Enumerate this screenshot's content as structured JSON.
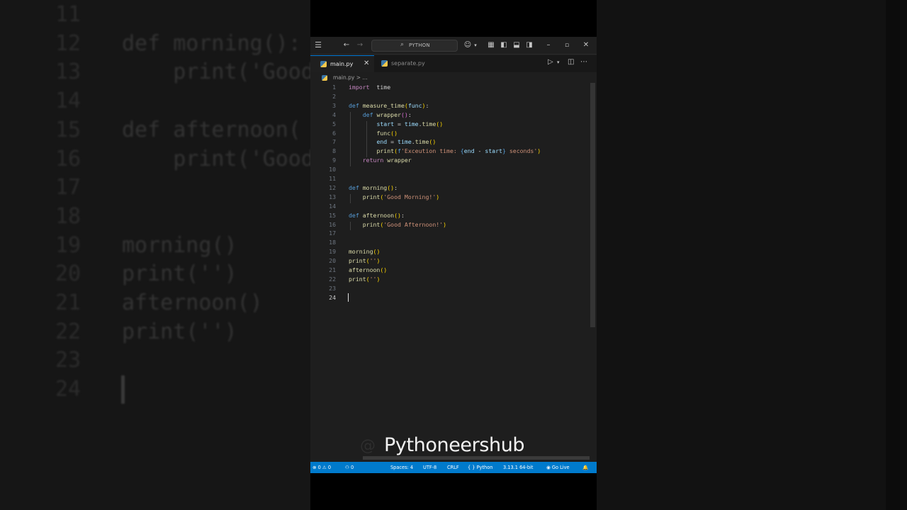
{
  "background": {
    "lines": [
      {
        "num": "11",
        "code": ""
      },
      {
        "num": "12",
        "code": "def morning():"
      },
      {
        "num": "13",
        "code": "    print('Good"
      },
      {
        "num": "14",
        "code": ""
      },
      {
        "num": "15",
        "code": "def afternoon("
      },
      {
        "num": "16",
        "code": "    print('Good"
      },
      {
        "num": "17",
        "code": ""
      },
      {
        "num": "18",
        "code": ""
      },
      {
        "num": "19",
        "code": "morning()"
      },
      {
        "num": "20",
        "code": "print('')"
      },
      {
        "num": "21",
        "code": "afternoon()"
      },
      {
        "num": "22",
        "code": "print('')"
      },
      {
        "num": "23",
        "code": ""
      },
      {
        "num": "24",
        "code": ""
      }
    ]
  },
  "titlebar": {
    "menu_icon": "menu-icon",
    "command_center_label": "PYTHON",
    "colors": {
      "background": "#1f1f1f",
      "accent": "#0078d4"
    }
  },
  "tabs": [
    {
      "label": "main.py",
      "active": true,
      "icon": "python-file-icon"
    },
    {
      "label": "separate.py",
      "active": false,
      "icon": "python-file-icon"
    }
  ],
  "breadcrumb": "main.py > ...",
  "editor": {
    "lines": [
      {
        "n": "1",
        "tokens": [
          [
            "kw2",
            "import"
          ],
          [
            "",
            "  time"
          ]
        ]
      },
      {
        "n": "2",
        "tokens": []
      },
      {
        "n": "3",
        "tokens": [
          [
            "kw",
            "def"
          ],
          [
            "",
            " "
          ],
          [
            "fn",
            "measure_time"
          ],
          [
            "pr",
            "("
          ],
          [
            "vr",
            "func"
          ],
          [
            "pr",
            ")"
          ],
          [
            "",
            ":"
          ]
        ]
      },
      {
        "n": "4",
        "tokens": [
          [
            "",
            "    "
          ],
          [
            "kw",
            "def"
          ],
          [
            "",
            " "
          ],
          [
            "fn",
            "wrapper"
          ],
          [
            "pr2",
            "()"
          ],
          [
            "",
            ":"
          ]
        ]
      },
      {
        "n": "5",
        "tokens": [
          [
            "",
            "        "
          ],
          [
            "vr",
            "start"
          ],
          [
            "",
            " = "
          ],
          [
            "vr",
            "time"
          ],
          [
            "",
            "."
          ],
          [
            "fn",
            "time"
          ],
          [
            "pr",
            "()"
          ]
        ]
      },
      {
        "n": "6",
        "tokens": [
          [
            "",
            "        "
          ],
          [
            "fn",
            "func"
          ],
          [
            "pr",
            "()"
          ]
        ]
      },
      {
        "n": "7",
        "tokens": [
          [
            "",
            "        "
          ],
          [
            "vr",
            "end"
          ],
          [
            "",
            " = "
          ],
          [
            "vr",
            "time"
          ],
          [
            "",
            "."
          ],
          [
            "fn",
            "time"
          ],
          [
            "pr",
            "()"
          ]
        ]
      },
      {
        "n": "8",
        "tokens": [
          [
            "",
            "        "
          ],
          [
            "fn",
            "print"
          ],
          [
            "pr",
            "("
          ],
          [
            "kw",
            "f"
          ],
          [
            "str",
            "'Exceution time: "
          ],
          [
            "kw",
            "{"
          ],
          [
            "vr",
            "end"
          ],
          [
            "",
            " - "
          ],
          [
            "vr",
            "start"
          ],
          [
            "kw",
            "}"
          ],
          [
            "str",
            " seconds'"
          ],
          [
            "pr",
            ")"
          ]
        ]
      },
      {
        "n": "9",
        "tokens": [
          [
            "",
            "    "
          ],
          [
            "kw2",
            "return"
          ],
          [
            "",
            " "
          ],
          [
            "fn",
            "wrapper"
          ]
        ]
      },
      {
        "n": "10",
        "tokens": []
      },
      {
        "n": "11",
        "tokens": []
      },
      {
        "n": "12",
        "tokens": [
          [
            "kw",
            "def"
          ],
          [
            "",
            " "
          ],
          [
            "fn",
            "morning"
          ],
          [
            "pr",
            "()"
          ],
          [
            "",
            ":"
          ]
        ]
      },
      {
        "n": "13",
        "tokens": [
          [
            "",
            "    "
          ],
          [
            "fn",
            "print"
          ],
          [
            "pr",
            "("
          ],
          [
            "str",
            "'Good Morning!'"
          ],
          [
            "pr",
            ")"
          ]
        ]
      },
      {
        "n": "14",
        "tokens": []
      },
      {
        "n": "15",
        "tokens": [
          [
            "kw",
            "def"
          ],
          [
            "",
            " "
          ],
          [
            "fn",
            "afternoon"
          ],
          [
            "pr",
            "()"
          ],
          [
            "",
            ":"
          ]
        ]
      },
      {
        "n": "16",
        "tokens": [
          [
            "",
            "    "
          ],
          [
            "fn",
            "print"
          ],
          [
            "pr",
            "("
          ],
          [
            "str",
            "'Good Afternoon!'"
          ],
          [
            "pr",
            ")"
          ]
        ]
      },
      {
        "n": "17",
        "tokens": []
      },
      {
        "n": "18",
        "tokens": []
      },
      {
        "n": "19",
        "tokens": [
          [
            "fn",
            "morning"
          ],
          [
            "pr",
            "()"
          ]
        ]
      },
      {
        "n": "20",
        "tokens": [
          [
            "fn",
            "print"
          ],
          [
            "pr",
            "("
          ],
          [
            "str",
            "''"
          ],
          [
            "pr",
            ")"
          ]
        ]
      },
      {
        "n": "21",
        "tokens": [
          [
            "fn",
            "afternoon"
          ],
          [
            "pr",
            "()"
          ]
        ]
      },
      {
        "n": "22",
        "tokens": [
          [
            "fn",
            "print"
          ],
          [
            "pr",
            "("
          ],
          [
            "str",
            "''"
          ],
          [
            "pr",
            ")"
          ]
        ]
      },
      {
        "n": "23",
        "tokens": []
      },
      {
        "n": "24",
        "tokens": [],
        "current": true
      }
    ]
  },
  "watermark": {
    "ghost": "@",
    "text": "Pythoneershub"
  },
  "statusbar": {
    "errors": "⊗ 0 ⚠ 0",
    "ports": "⚇ 0",
    "spaces": "Spaces: 4",
    "encoding": "UTF-8",
    "eol": "CRLF",
    "language": "{ } Python",
    "interpreter": "3.13.1 64-bit",
    "golive": "◉ Go Live",
    "bell": "🔔",
    "color": "#007acc"
  }
}
